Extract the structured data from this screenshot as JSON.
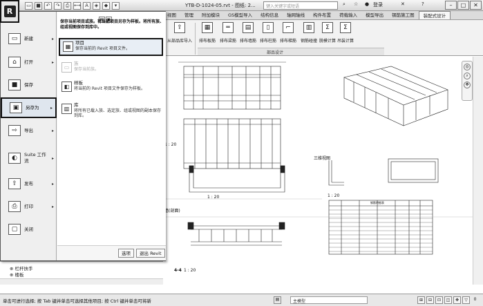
{
  "title_bar": {
    "window_title": "YTB-D-1024-05.rvt - 图纸: 2...",
    "search_placeholder": "键入关键字或短语",
    "login_label": "登录",
    "help_label": "?"
  },
  "ribbon": {
    "tabs": [
      "视图",
      "管理",
      "附加模块",
      "GS模型导入",
      "结构信息",
      "轴网轴线",
      "构件布置",
      "荷载输入",
      "模型导出",
      "钢筋施工图",
      "装配式设计"
    ],
    "active_tab": "装配式设计",
    "buttons": [
      {
        "label": "从部品库导入",
        "icon": "import-icon"
      },
      {
        "label": "排布板筋",
        "icon": "grid-icon"
      },
      {
        "label": "排布梁筋",
        "icon": "beam-icon"
      },
      {
        "label": "排布墙筋",
        "icon": "wall-icon"
      },
      {
        "label": "排布柱筋",
        "icon": "column-icon"
      },
      {
        "label": "排布梯筋",
        "icon": "stair-icon"
      },
      {
        "label": "钢筋碰撞",
        "icon": "clash-icon"
      },
      {
        "label": "脱模计算",
        "icon": "sigma-icon"
      },
      {
        "label": "吊装计算",
        "icon": "sigma-icon"
      }
    ],
    "panel_label": "部品设计"
  },
  "app_menu": {
    "items": [
      {
        "label": "新建",
        "icon": "new-file-icon",
        "has_arrow": true
      },
      {
        "label": "打开",
        "icon": "open-folder-icon",
        "has_arrow": true
      },
      {
        "label": "保存",
        "icon": "save-icon",
        "has_arrow": false
      },
      {
        "label": "另存为",
        "icon": "save-as-icon",
        "has_arrow": true,
        "selected": true
      },
      {
        "label": "导出",
        "icon": "export-icon",
        "has_arrow": true
      },
      {
        "label": "Suite 工作流",
        "icon": "suite-icon",
        "has_arrow": true
      },
      {
        "label": "发布",
        "icon": "publish-icon",
        "has_arrow": true
      },
      {
        "label": "打印",
        "icon": "print-icon",
        "has_arrow": true
      },
      {
        "label": "关闭",
        "icon": "close-doc-icon",
        "has_arrow": false
      }
    ],
    "submenu_title": "保存当前项目或族。将当前项目另存为样板。将所有族、组或视图保存到库中。",
    "submenu": [
      {
        "title": "项目",
        "desc": "保存当前的 Revit 项目文件。",
        "selected": true,
        "disabled": false
      },
      {
        "title": "族",
        "desc": "保存当前族。",
        "selected": false,
        "disabled": true
      },
      {
        "title": "样板",
        "desc": "将当前的 Revit 项目文件保存为样板。",
        "selected": false,
        "disabled": false
      },
      {
        "title": "库",
        "desc": "将所有已载入族、选定族、组或视图的副本保存到库。",
        "selected": false,
        "disabled": false
      }
    ],
    "options_label": "选项",
    "exit_label": "退出 Revit"
  },
  "project_browser": {
    "items": [
      "栏杆扶手",
      "楼板"
    ]
  },
  "drawing": {
    "labels": [
      "1 : 20",
      "1 : 20",
      "墙(剖面)",
      "4-4",
      "1 : 20",
      "三维视图",
      "1 : 20"
    ],
    "table_title": "钢筋明细表"
  },
  "status_bar": {
    "text": "单击可进行选择; 按 Tab 键并单击可选择其他项目; 按 Ctrl 键并单击可将新",
    "workset": "主模型",
    "zoom": "0"
  }
}
